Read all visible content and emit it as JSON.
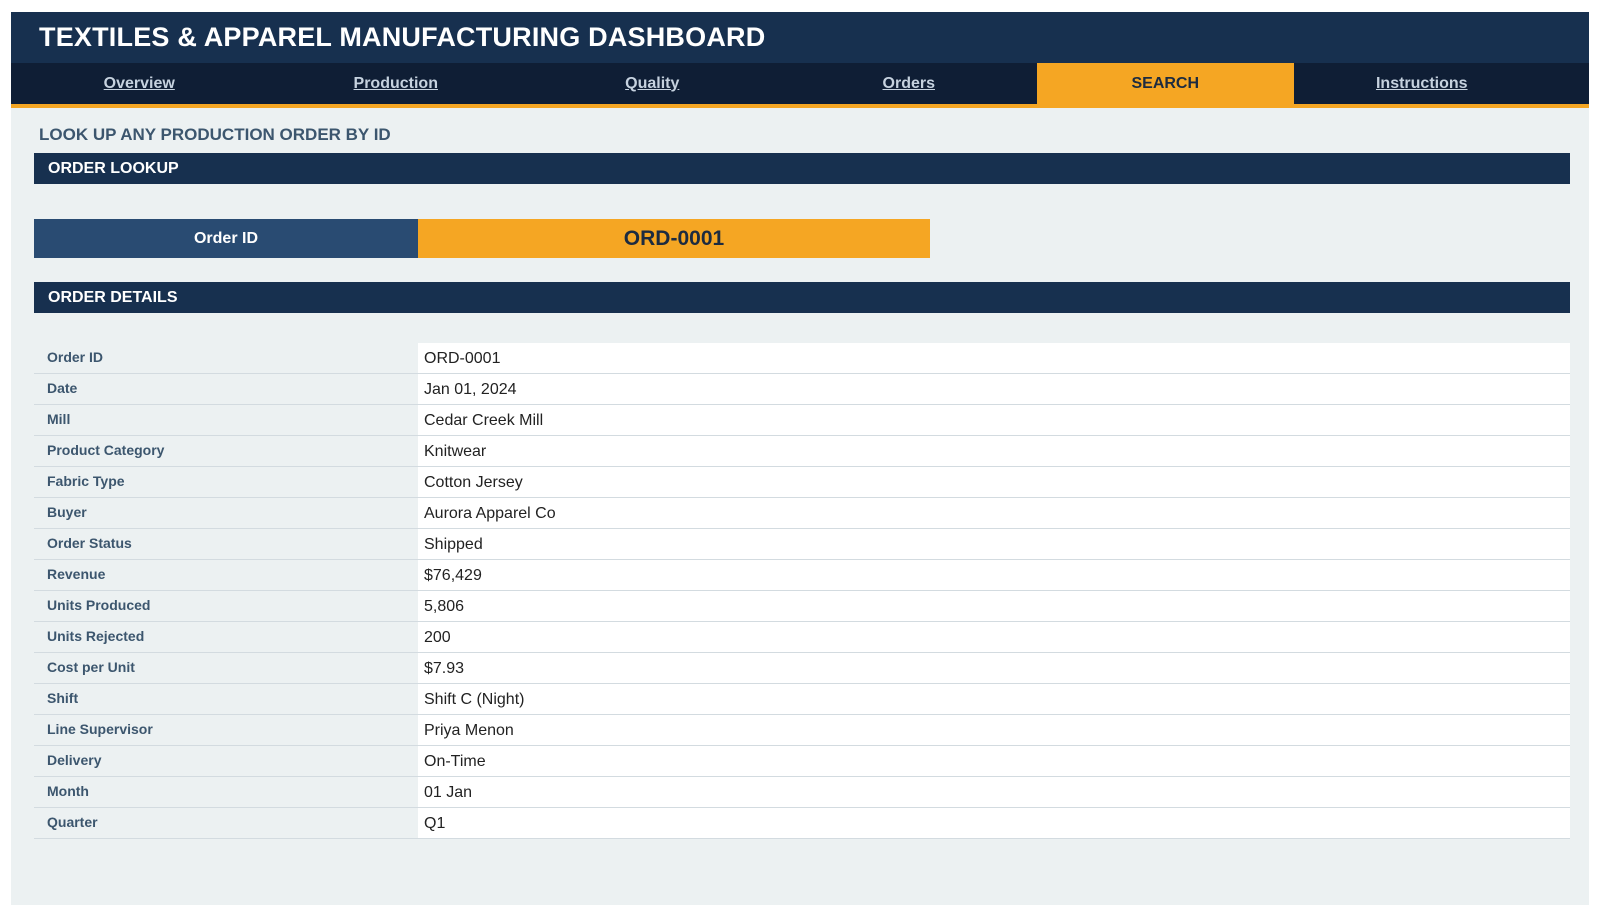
{
  "header": {
    "title": "TEXTILES & APPAREL MANUFACTURING DASHBOARD"
  },
  "nav": {
    "tabs": [
      {
        "label": "Overview",
        "active": false
      },
      {
        "label": "Production",
        "active": false
      },
      {
        "label": "Quality",
        "active": false
      },
      {
        "label": "Orders",
        "active": false
      },
      {
        "label": "SEARCH",
        "active": true
      },
      {
        "label": "Instructions",
        "active": false
      }
    ]
  },
  "page": {
    "subtitle": "LOOK UP ANY PRODUCTION ORDER BY ID",
    "lookup_title": "ORDER LOOKUP",
    "details_title": "ORDER DETAILS"
  },
  "lookup": {
    "label": "Order ID",
    "value": "ORD-0001"
  },
  "details": [
    {
      "key": "Order ID",
      "value": "ORD-0001"
    },
    {
      "key": "Date",
      "value": "Jan 01, 2024"
    },
    {
      "key": "Mill",
      "value": "Cedar Creek Mill"
    },
    {
      "key": "Product Category",
      "value": "Knitwear"
    },
    {
      "key": "Fabric Type",
      "value": "Cotton Jersey"
    },
    {
      "key": "Buyer",
      "value": "Aurora Apparel Co"
    },
    {
      "key": "Order Status",
      "value": "Shipped"
    },
    {
      "key": "Revenue",
      "value": "$76,429"
    },
    {
      "key": "Units Produced",
      "value": "5,806"
    },
    {
      "key": "Units Rejected",
      "value": "200"
    },
    {
      "key": "Cost per Unit",
      "value": "$7.93"
    },
    {
      "key": "Shift",
      "value": "Shift C (Night)"
    },
    {
      "key": "Line Supervisor",
      "value": "Priya Menon"
    },
    {
      "key": "Delivery",
      "value": "On-Time"
    },
    {
      "key": "Month",
      "value": "01 Jan"
    },
    {
      "key": "Quarter",
      "value": "Q1"
    }
  ],
  "colors": {
    "header": "#17304f",
    "nav": "#0f1e35",
    "accent": "#f5a623",
    "label_block": "#294b72",
    "background": "#ecf1f2"
  }
}
